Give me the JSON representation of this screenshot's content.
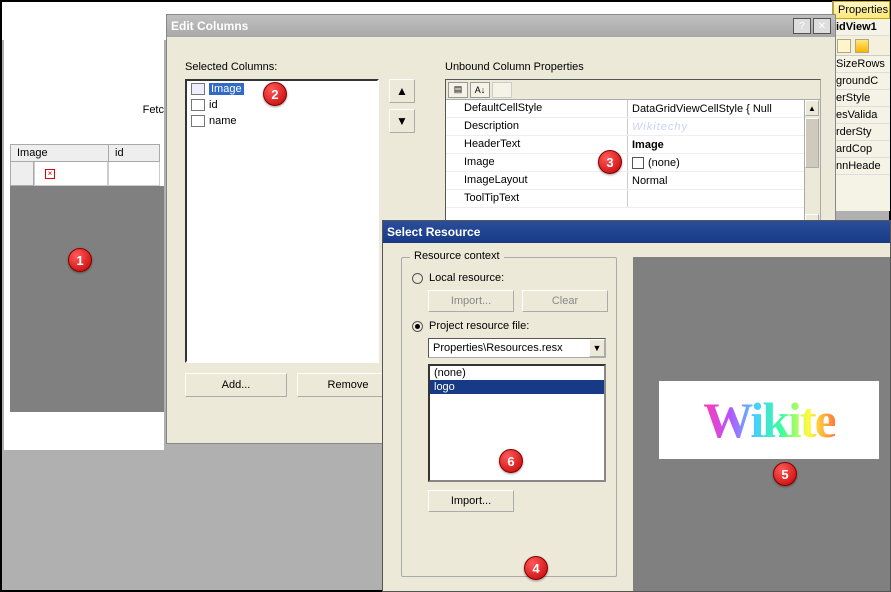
{
  "back": {
    "fetch_label": "Fetc",
    "cols": {
      "image": "Image",
      "id": "id"
    }
  },
  "editColumns": {
    "title": "Edit Columns",
    "selected_label": "Selected Columns:",
    "items": [
      {
        "label": "Image",
        "selected": true
      },
      {
        "label": "id",
        "selected": false
      },
      {
        "label": "name",
        "selected": false
      }
    ],
    "unbound_label": "Unbound Column Properties",
    "add_label": "Add...",
    "remove_label": "Remove",
    "props": [
      {
        "name": "DefaultCellStyle",
        "value": "DataGridViewCellStyle { Null"
      },
      {
        "name": "Description",
        "value": ""
      },
      {
        "name": "HeaderText",
        "value": "Image",
        "bold": true
      },
      {
        "name": "Image",
        "value": "(none)",
        "checkbox": true
      },
      {
        "name": "ImageLayout",
        "value": "Normal"
      },
      {
        "name": "ToolTipText",
        "value": ""
      }
    ]
  },
  "selectResource": {
    "title": "Select Resource",
    "group_label": "Resource context",
    "local_label": "Local resource:",
    "import_label": "Import...",
    "clear_label": "Clear",
    "project_label": "Project resource file:",
    "combo_value": "Properties\\Resources.resx",
    "list": [
      {
        "label": "(none)",
        "selected": false
      },
      {
        "label": "logo",
        "selected": true
      }
    ],
    "import2_label": "Import...",
    "preview_text": "Wikite"
  },
  "propsSidebar": {
    "title": "Properties",
    "line1": "idView1",
    "rows": [
      "SizeRows",
      "groundC",
      "erStyle",
      "esValida",
      "rderSty",
      "ardCop",
      "nnHeade"
    ]
  },
  "callouts": {
    "1": "1",
    "2": "2",
    "3": "3",
    "4": "4",
    "5": "5",
    "6": "6"
  },
  "watermark": "Wikitechy"
}
